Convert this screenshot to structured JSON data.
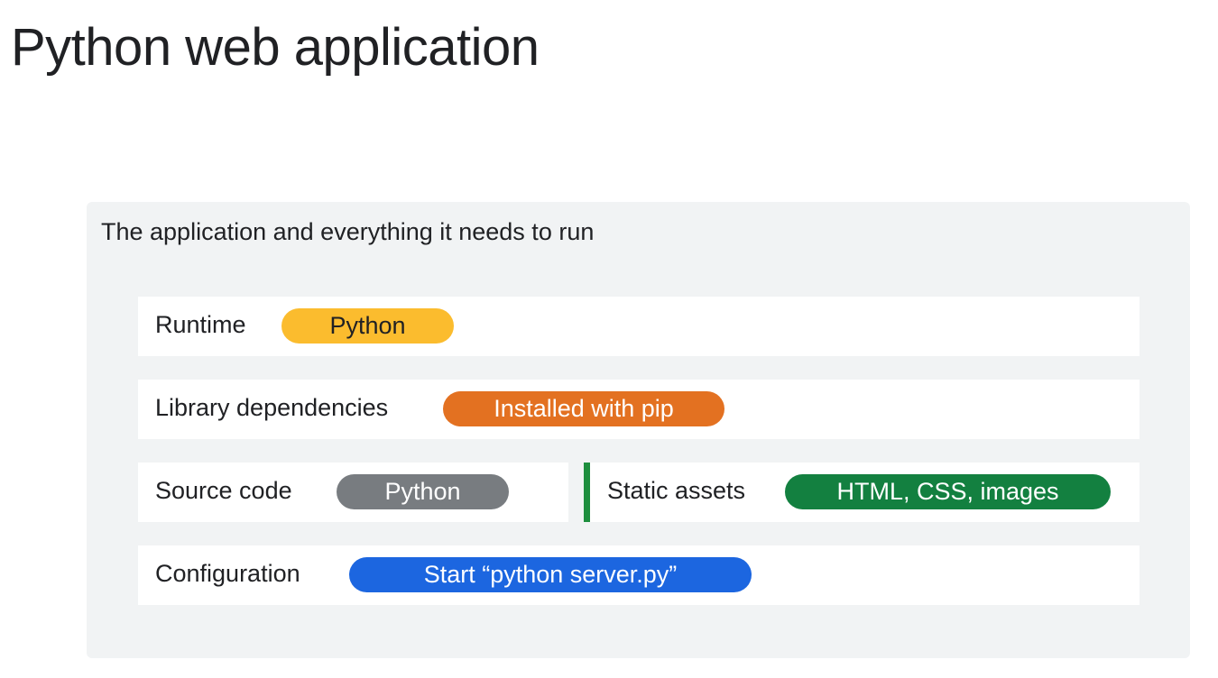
{
  "title": "Python web application",
  "container": {
    "heading": "The application and everything it needs to run"
  },
  "rows": {
    "runtime": {
      "label": "Runtime",
      "pill": "Python",
      "color": "#fbbc2e",
      "text_color": "#202124"
    },
    "library": {
      "label": "Library dependencies",
      "pill": "Installed with pip",
      "color": "#e37121",
      "text_color": "#ffffff"
    },
    "source": {
      "label": "Source code",
      "pill": "Python",
      "color": "#787c80",
      "text_color": "#ffffff"
    },
    "static": {
      "label": "Static assets",
      "pill": "HTML, CSS, images",
      "color": "#138040",
      "text_color": "#ffffff"
    },
    "config": {
      "label": "Configuration",
      "pill": "Start “python server.py”",
      "color": "#1c66e0",
      "text_color": "#ffffff"
    }
  },
  "divider_color": "#1e8e3e"
}
